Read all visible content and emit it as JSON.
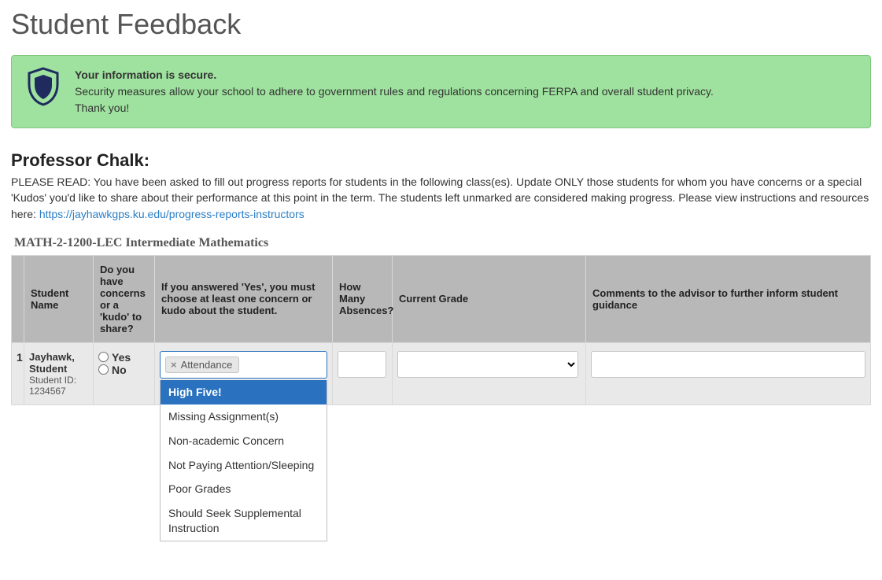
{
  "pageTitle": "Student Feedback",
  "secure": {
    "title": "Your information is secure.",
    "line1": "Security measures allow your school to adhere to government rules and regulations concerning FERPA and overall student privacy.",
    "line2": "Thank you!"
  },
  "professorHeading": "Professor Chalk:",
  "instructionsPrefix": "PLEASE READ: You have been asked to fill out progress reports for students in the following class(es). Update ONLY those students for whom you have concerns or a special 'Kudos' you'd like to share about their performance at this point in the term. The students left unmarked are considered making progress. Please view instructions and resources here: ",
  "instructionsLinkText": "https://jayhawkgps.ku.edu/progress-reports-instructors",
  "courseTitle": "MATH-2-1200-LEC Intermediate Mathematics",
  "headers": {
    "name": "Student Name",
    "concerns": "Do you have concerns or a 'kudo' to share?",
    "reasons": "If you answered 'Yes', you must choose at least one concern or kudo about the student.",
    "absences": "How Many Absences?",
    "grade": "Current Grade",
    "comments": "Comments to the advisor to further inform student guidance"
  },
  "row": {
    "index": "1",
    "studentName": "Jayhawk, Student",
    "studentIdLabel": "Student ID: 1234567",
    "yesLabel": "Yes",
    "noLabel": "No",
    "selectedTag": "Attendance",
    "absencesValue": "",
    "gradeValue": "",
    "commentsValue": ""
  },
  "dropdownOptions": [
    {
      "label": "High Five!",
      "selected": true
    },
    {
      "label": "Missing Assignment(s)",
      "selected": false
    },
    {
      "label": "Non-academic Concern",
      "selected": false
    },
    {
      "label": "Not Paying Attention/Sleeping",
      "selected": false
    },
    {
      "label": "Poor Grades",
      "selected": false
    },
    {
      "label": "Should Seek Supplemental Instruction",
      "selected": false
    }
  ]
}
